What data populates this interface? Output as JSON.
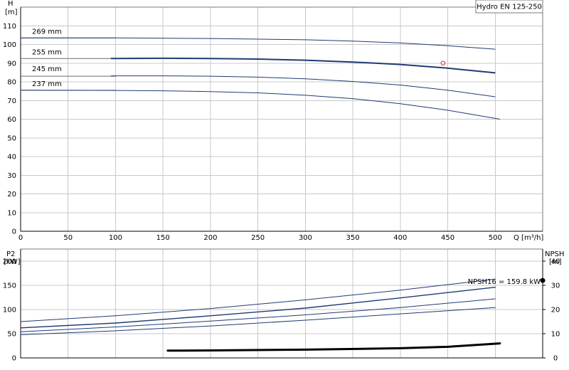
{
  "chart_data": [
    {
      "type": "line",
      "title": "Hydro EN 125-250",
      "ylabel": [
        "H",
        "[m]"
      ],
      "xlabel": "Q [m³/h]",
      "xlim": [
        0,
        550
      ],
      "ylim": [
        0,
        120
      ],
      "xticks": [
        0,
        50,
        100,
        150,
        200,
        250,
        300,
        350,
        400,
        450,
        500
      ],
      "yticks": [
        0,
        10,
        20,
        30,
        40,
        50,
        60,
        70,
        80,
        90,
        100,
        110
      ],
      "grid": true,
      "reference_lines": [
        {
          "y": 103.5,
          "x_end": 100
        },
        {
          "y": 92.5,
          "x_end": 100
        },
        {
          "y": 83,
          "x_end": 100
        },
        {
          "y": 75.5,
          "x_end": 100
        }
      ],
      "series": [
        {
          "name": "269 mm",
          "x": [
            0,
            100,
            200,
            300,
            350,
            400,
            450,
            500
          ],
          "y": [
            103.5,
            103.5,
            103.2,
            102.5,
            101.8,
            100.8,
            99.3,
            97.5
          ],
          "color": "#1f3b73",
          "weight": 1
        },
        {
          "name": "255 mm",
          "x": [
            95,
            150,
            200,
            250,
            300,
            350,
            400,
            450,
            500
          ],
          "y": [
            92.5,
            92.6,
            92.5,
            92.2,
            91.6,
            90.6,
            89.3,
            87.3,
            84.8
          ],
          "color": "#1f3b73",
          "weight": 2
        },
        {
          "name": "245 mm",
          "x": [
            95,
            150,
            200,
            250,
            300,
            350,
            400,
            450,
            500
          ],
          "y": [
            83.2,
            83.2,
            83,
            82.5,
            81.6,
            80.2,
            78.3,
            75.5,
            72
          ],
          "color": "#1f3b73",
          "weight": 1
        },
        {
          "name": "237 mm",
          "x": [
            0,
            100,
            150,
            200,
            250,
            300,
            350,
            400,
            450,
            505
          ],
          "y": [
            75.5,
            75.4,
            75.2,
            74.8,
            74.1,
            72.8,
            71,
            68.3,
            64.8,
            60
          ],
          "color": "#1f3b73",
          "weight": 1
        }
      ],
      "series_labels_x": 12,
      "series_labels_y": [
        107,
        96,
        87,
        79
      ],
      "operating_point": {
        "x": 445,
        "y": 90,
        "color": "#e03030"
      }
    },
    {
      "type": "line",
      "ylabel_left": [
        "P2",
        "[kW]"
      ],
      "ylabel_right": [
        "NPSH",
        "[m]"
      ],
      "xlim": [
        0,
        550
      ],
      "ylim_left": [
        0,
        225
      ],
      "ylim_right": [
        0,
        45
      ],
      "xticks": [
        0,
        50,
        100,
        150,
        200,
        250,
        300,
        350,
        400,
        450,
        500
      ],
      "yticks_left": [
        0,
        50,
        100,
        150,
        200
      ],
      "yticks_right": [
        0,
        10,
        20,
        30,
        40
      ],
      "grid": true,
      "annotation": {
        "text": "NPSH16 = 159.8 kW",
        "marker_value": 32,
        "marker_axis": "right"
      },
      "series": [
        {
          "x": [
            0,
            100,
            200,
            300,
            400,
            500
          ],
          "y": [
            75,
            87,
            102,
            120,
            140,
            163
          ],
          "axis": "left",
          "weight": 1
        },
        {
          "x": [
            0,
            100,
            200,
            300,
            400,
            500
          ],
          "y": [
            62,
            72,
            87,
            103,
            124,
            146
          ],
          "axis": "left",
          "weight": 1.4
        },
        {
          "x": [
            0,
            100,
            200,
            300,
            400,
            500
          ],
          "y": [
            54,
            64,
            76,
            89,
            104,
            122
          ],
          "axis": "left",
          "weight": 1
        },
        {
          "x": [
            0,
            100,
            200,
            300,
            400,
            500
          ],
          "y": [
            48,
            56,
            66,
            78,
            91,
            104
          ],
          "axis": "left",
          "weight": 1
        },
        {
          "x": [
            155,
            200,
            300,
            400,
            450,
            505
          ],
          "y": [
            3.0,
            3.1,
            3.4,
            4.0,
            4.6,
            6.0
          ],
          "axis": "right",
          "weight": 3
        }
      ]
    }
  ]
}
